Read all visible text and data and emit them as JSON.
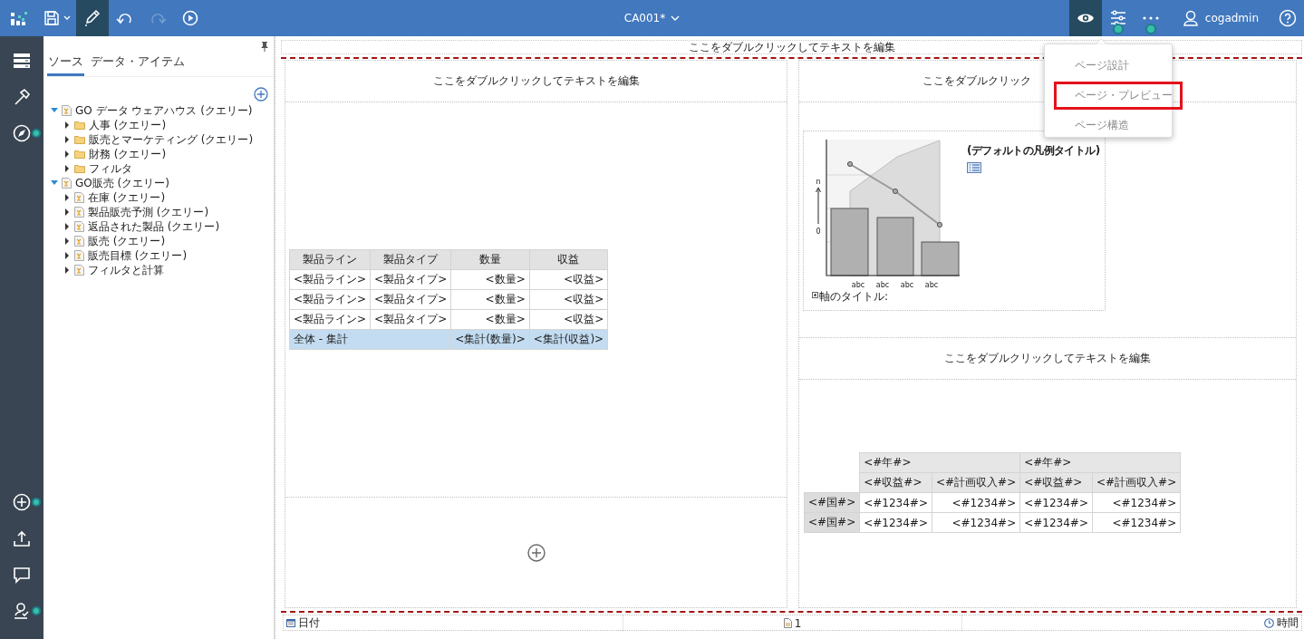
{
  "toolbar": {
    "title": "CA001*",
    "user": "cogadmin",
    "left_tools": [
      {
        "kind": "logo",
        "selected": false,
        "disabled": false
      },
      {
        "kind": "save",
        "selected": false,
        "disabled": false
      },
      {
        "kind": "edit",
        "selected": true,
        "disabled": false
      },
      {
        "kind": "undo",
        "selected": false,
        "disabled": false
      },
      {
        "kind": "redo",
        "selected": false,
        "disabled": true
      },
      {
        "kind": "run",
        "selected": false,
        "disabled": false
      }
    ],
    "right_tools": [
      {
        "kind": "view",
        "selected": true,
        "badge": false
      },
      {
        "kind": "properties",
        "selected": false,
        "badge": true
      },
      {
        "kind": "more",
        "selected": false,
        "badge": true
      }
    ]
  },
  "rail": {
    "top": [
      {
        "kind": "data",
        "badge": false
      },
      {
        "kind": "toolbox",
        "badge": false
      },
      {
        "kind": "navigate",
        "badge": true
      }
    ],
    "bottom": [
      {
        "kind": "add",
        "badge": true
      },
      {
        "kind": "upload",
        "badge": false
      },
      {
        "kind": "comment",
        "badge": false
      },
      {
        "kind": "validate",
        "badge": true
      }
    ]
  },
  "source_panel": {
    "tabs": [
      {
        "label": "ソース",
        "selected": true
      },
      {
        "label": "データ・アイテム",
        "selected": false
      }
    ],
    "tree": [
      {
        "label": "GO データ ウェアハウス (クエリー)",
        "kind": "package",
        "expanded": true,
        "children": [
          {
            "label": "人事 (クエリー)",
            "kind": "folder",
            "expanded": false
          },
          {
            "label": "販売とマーケティング (クエリー)",
            "kind": "folder",
            "expanded": false
          },
          {
            "label": "財務 (クエリー)",
            "kind": "folder",
            "expanded": false
          },
          {
            "label": "フィルタ",
            "kind": "folder",
            "expanded": false
          }
        ]
      },
      {
        "label": "GO販売 (クエリー)",
        "kind": "package",
        "expanded": true,
        "children": [
          {
            "label": "在庫 (クエリー)",
            "kind": "query",
            "expanded": false
          },
          {
            "label": "製品販売予測 (クエリー)",
            "kind": "query",
            "expanded": false
          },
          {
            "label": "返品された製品 (クエリー)",
            "kind": "query",
            "expanded": false
          },
          {
            "label": "販売 (クエリー)",
            "kind": "query",
            "expanded": false
          },
          {
            "label": "販売目標 (クエリー)",
            "kind": "query",
            "expanded": false
          },
          {
            "label": "フィルタと計算",
            "kind": "query",
            "expanded": false
          }
        ]
      }
    ]
  },
  "report": {
    "page_header": "ここをダブルクリックしてテキストを編集",
    "left_column": {
      "header": "ここをダブルクリックしてテキストを編集",
      "list": {
        "columns": [
          "製品ライン",
          "製品タイプ",
          "数量",
          "収益"
        ],
        "rows": [
          [
            "<製品ライン>",
            "<製品タイプ>",
            "<数量>",
            "<収益>"
          ],
          [
            "<製品ライン>",
            "<製品タイプ>",
            "<数量>",
            "<収益>"
          ],
          [
            "<製品ライン>",
            "<製品タイプ>",
            "<数量>",
            "<収益>"
          ]
        ],
        "total": {
          "label": "全体 - 集計",
          "cells": [
            "<集計(数量)>",
            "<集計(収益)>"
          ]
        }
      }
    },
    "right_top": {
      "header": "ここをダブルクリック",
      "chart": {
        "legend_title": "(デフォルトの凡例タイトル)",
        "y_labels": [
          "n",
          "0"
        ],
        "x_labels": [
          "abc",
          "abc",
          "abc",
          "abc"
        ],
        "axis_title": "軸のタイトル:"
      }
    },
    "right_bottom": {
      "header": "ここをダブルクリックしてテキストを編集",
      "crosstab": {
        "column_groups": [
          "<#年#>",
          "<#年#>"
        ],
        "measures": [
          "<#収益#>",
          "<#計画収入#>",
          "<#収益#>",
          "<#計画収入#>"
        ],
        "rows": [
          {
            "label": "<#国#>",
            "cells": [
              "<#1234#>",
              "<#1234#>",
              "<#1234#>",
              "<#1234#>"
            ]
          },
          {
            "label": "<#国#>",
            "cells": [
              "<#1234#>",
              "<#1234#>",
              "<#1234#>",
              "<#1234#>"
            ]
          }
        ]
      }
    },
    "footer": {
      "date": "日付",
      "page": "1",
      "time": "時間"
    }
  },
  "menu": {
    "items": [
      {
        "label": "ページ設計",
        "highlighted": false
      },
      {
        "label": "ページ・プレビュー",
        "highlighted": true
      },
      {
        "label": "ページ構造",
        "highlighted": false
      }
    ]
  }
}
